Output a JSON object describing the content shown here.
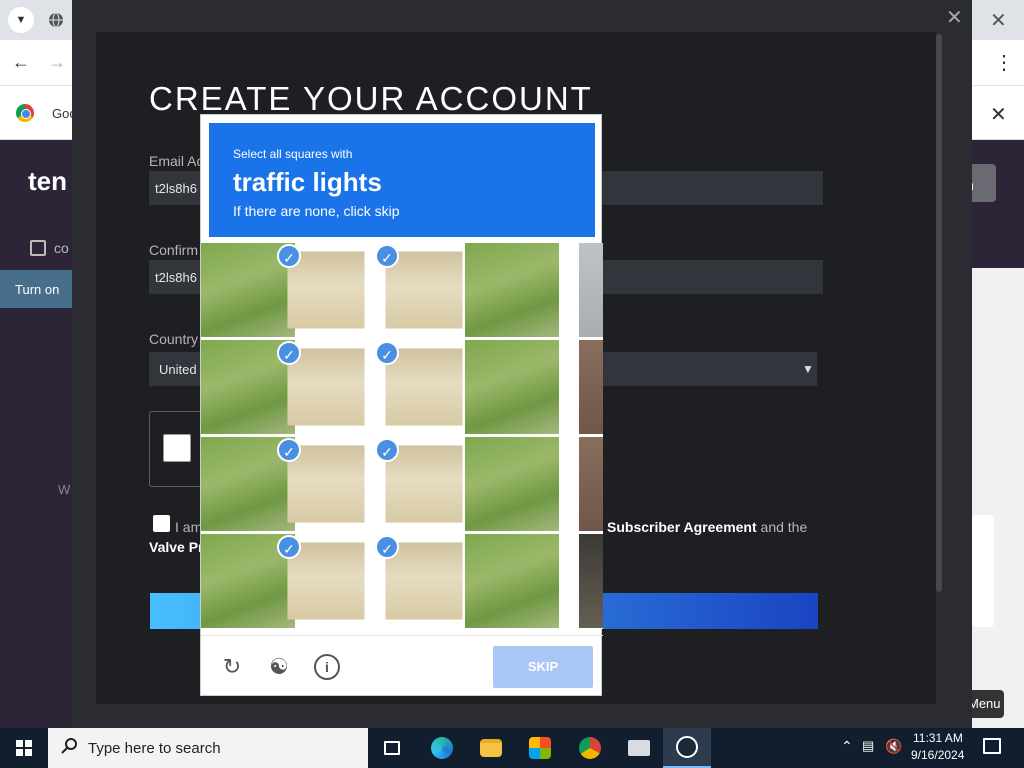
{
  "browser": {
    "infobar_text": "Goo",
    "icons": [
      "chevron-down-icon",
      "globe-icon",
      "close-icon",
      "back-arrow-icon",
      "forward-arrow-icon",
      "kebab-menu-icon",
      "chrome-logo-icon"
    ]
  },
  "tenor": {
    "logo": "ten",
    "nav_item": "co",
    "turn_on": "Turn on",
    "side_text": "W",
    "right_btn": "n",
    "menu": "Menu"
  },
  "steam": {
    "title": "CREATE YOUR ACCOUNT",
    "email_label": "Email Ac",
    "email_value": "t2ls8h6",
    "confirm_label": "Confirm",
    "confirm_value": "t2ls8h6",
    "country_label": "Country",
    "country_value": "United",
    "agree_left": "I am",
    "agree_subscriber": "Subscriber Agreement",
    "agree_and_the": "and the",
    "agree_valve": "Valve Pr"
  },
  "captcha": {
    "select_text": "Select all squares with",
    "object": "traffic lights",
    "skip_hint": "If there are none, click skip",
    "skip_label": "SKIP",
    "tiles": [
      {
        "kind": "grass",
        "selected": false
      },
      {
        "kind": "hydrant",
        "selected": true
      },
      {
        "kind": "hydrant",
        "selected": true
      },
      {
        "kind": "grass",
        "selected": false
      },
      {
        "kind": "road",
        "selected": false
      },
      {
        "kind": "grass",
        "selected": false
      },
      {
        "kind": "hydrant",
        "selected": true
      },
      {
        "kind": "hydrant",
        "selected": true
      },
      {
        "kind": "grass",
        "selected": false
      },
      {
        "kind": "house",
        "selected": false
      },
      {
        "kind": "grass",
        "selected": false
      },
      {
        "kind": "hydrant",
        "selected": true
      },
      {
        "kind": "hydrant",
        "selected": true
      },
      {
        "kind": "grass",
        "selected": false
      },
      {
        "kind": "house",
        "selected": false
      },
      {
        "kind": "grass",
        "selected": false
      },
      {
        "kind": "hydrant",
        "selected": true
      },
      {
        "kind": "hydrant",
        "selected": true
      },
      {
        "kind": "grass",
        "selected": false
      },
      {
        "kind": "dark",
        "selected": false
      }
    ],
    "icons": [
      "reload-icon",
      "headphones-icon",
      "info-icon"
    ],
    "colors": {
      "header": "#1a73e8",
      "tick": "#4a90e2",
      "skip": "#a9c6f5"
    }
  },
  "taskbar": {
    "search_placeholder": "Type here to search",
    "apps": [
      "task-view-icon",
      "edge-icon",
      "file-explorer-icon",
      "store-icon",
      "chrome-icon",
      "mail-icon",
      "steam-icon"
    ],
    "time": "11:31 AM",
    "date": "9/16/2024"
  }
}
